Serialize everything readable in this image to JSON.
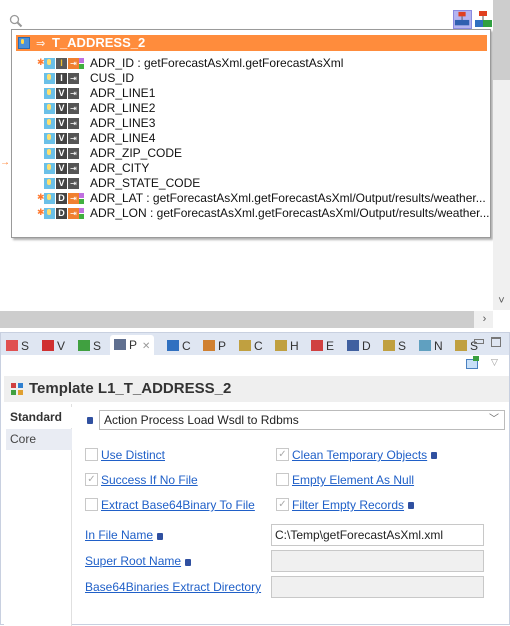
{
  "diagram": {
    "entity": {
      "name": "T_ADDRESS_2",
      "columns": [
        {
          "name": "ADR_ID : getForecastAsXml.getForecastAsXml",
          "type": "I",
          "pk": true,
          "mapped": true,
          "marked": true
        },
        {
          "name": "CUS_ID",
          "type": "I",
          "pk": false,
          "mapped": false,
          "marked": false
        },
        {
          "name": "ADR_LINE1",
          "type": "V",
          "pk": false,
          "mapped": false,
          "marked": false
        },
        {
          "name": "ADR_LINE2",
          "type": "V",
          "pk": false,
          "mapped": false,
          "marked": false
        },
        {
          "name": "ADR_LINE3",
          "type": "V",
          "pk": false,
          "mapped": false,
          "marked": false
        },
        {
          "name": "ADR_LINE4",
          "type": "V",
          "pk": false,
          "mapped": false,
          "marked": false
        },
        {
          "name": "ADR_ZIP_CODE",
          "type": "V",
          "pk": false,
          "mapped": false,
          "marked": false
        },
        {
          "name": "ADR_CITY",
          "type": "V",
          "pk": false,
          "mapped": false,
          "marked": false
        },
        {
          "name": "ADR_STATE_CODE",
          "type": "V",
          "pk": false,
          "mapped": false,
          "marked": false
        },
        {
          "name": "ADR_LAT : getForecastAsXml.getForecastAsXml/Output/results/weather...",
          "type": "D",
          "pk": false,
          "mapped": true,
          "marked": true
        },
        {
          "name": "ADR_LON : getForecastAsXml.getForecastAsXml/Output/results/weather...",
          "type": "D",
          "pk": false,
          "mapped": true,
          "marked": true
        }
      ]
    },
    "toolbar_icons": [
      "load-icon",
      "integration-icon"
    ]
  },
  "panel": {
    "tabs": [
      {
        "label": "S",
        "icon": "sort-icon"
      },
      {
        "label": "V",
        "icon": "variables-icon"
      },
      {
        "label": "S",
        "icon": "statistics-icon"
      },
      {
        "label": "P",
        "icon": "properties-icon",
        "active": true
      },
      {
        "label": "C",
        "icon": "console-icon"
      },
      {
        "label": "P",
        "icon": "progress-icon"
      },
      {
        "label": "C",
        "icon": "connections-icon"
      },
      {
        "label": "H",
        "icon": "history-icon"
      },
      {
        "label": "E",
        "icon": "errors-icon"
      },
      {
        "label": "D",
        "icon": "diagram-icon"
      },
      {
        "label": "S",
        "icon": "search-results-icon"
      },
      {
        "label": "N",
        "icon": "navigator-icon"
      },
      {
        "label": "S",
        "icon": "session-icon"
      }
    ],
    "title": "Template L1_T_ADDRESS_2",
    "side_tabs": [
      "Standard",
      "Core"
    ],
    "template_value": "Action Process Load Wsdl to Rdbms",
    "checkboxes": [
      {
        "label": "Use Distinct",
        "checked": false,
        "info": false
      },
      {
        "label": "Clean Temporary Objects",
        "checked": true,
        "info": true
      },
      {
        "label": "Success If No File",
        "checked": true,
        "info": false
      },
      {
        "label": "Empty Element As Null",
        "checked": false,
        "info": false
      },
      {
        "label": "Extract Base64Binary To File",
        "checked": false,
        "info": false
      },
      {
        "label": "Filter Empty Records",
        "checked": true,
        "info": true
      }
    ],
    "fields": [
      {
        "label": "In File Name",
        "value": "C:\\Temp\\getForecastAsXml.xml",
        "info": true,
        "disabled": false
      },
      {
        "label": "Super Root Name",
        "value": "",
        "info": true,
        "disabled": true
      },
      {
        "label": "Base64Binaries Extract Directory",
        "value": "",
        "info": false,
        "disabled": true
      }
    ]
  }
}
